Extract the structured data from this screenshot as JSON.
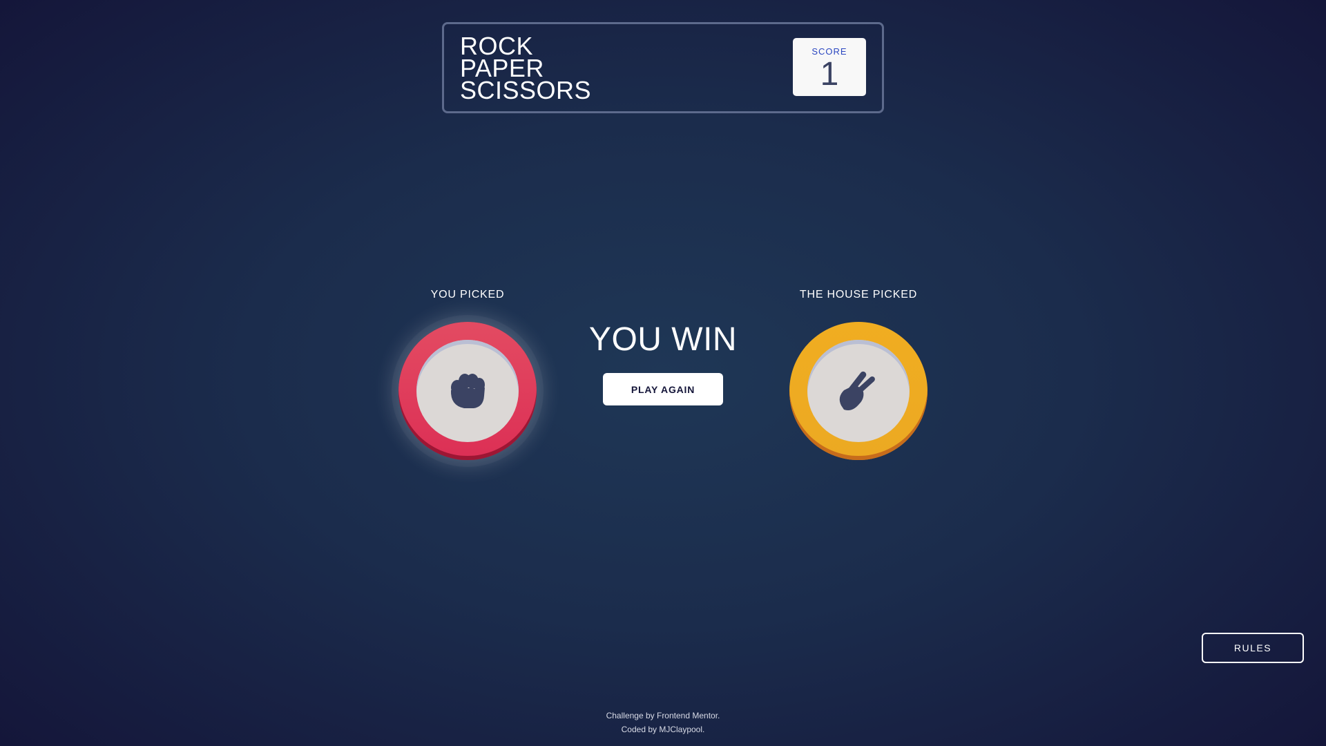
{
  "header": {
    "title_lines": [
      "ROCK",
      "PAPER",
      "SCISSORS"
    ],
    "score_label": "SCORE",
    "score_value": "1"
  },
  "player": {
    "label": "YOU PICKED",
    "choice": "rock",
    "icon": "rock-hand-icon",
    "ring_color": "#dc2f55"
  },
  "house": {
    "label": "THE HOUSE PICKED",
    "choice": "scissors",
    "icon": "scissors-hand-icon",
    "ring_color": "#eca922"
  },
  "result": {
    "text": "YOU WIN",
    "play_again_label": "PLAY AGAIN"
  },
  "rules_button_label": "RULES",
  "footer": {
    "line1_prefix": "Challenge by ",
    "line1_link": "Frontend Mentor",
    "line1_suffix": ".",
    "line2_prefix": "Coded by ",
    "line2_link": "MJClaypool",
    "line2_suffix": "."
  },
  "colors": {
    "background_dark": "#141539",
    "background_light": "#1f3756",
    "header_border": "#5d6a8c",
    "score_label": "#2a46c0",
    "score_value": "#3b4363",
    "icon_fill": "#3b4363"
  }
}
